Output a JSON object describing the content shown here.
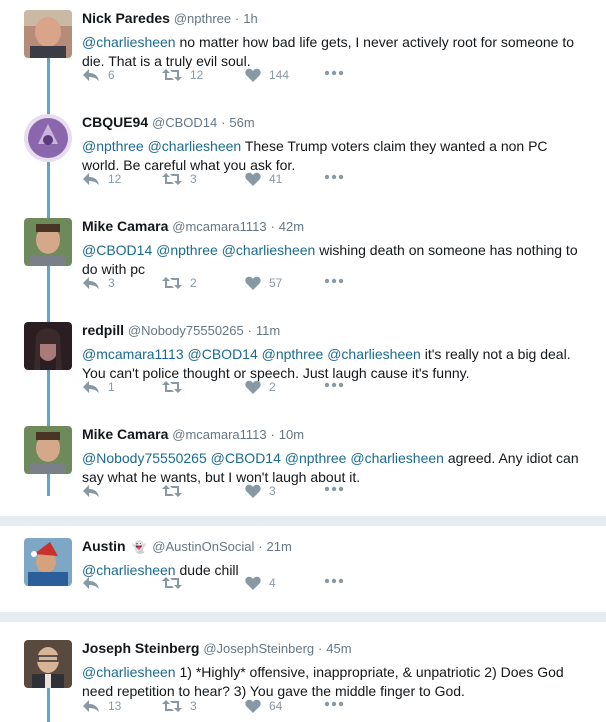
{
  "tweets_group1": [
    {
      "name": "Nick Paredes",
      "handle": "@npthree",
      "time": "1h",
      "mentions": "@charliesheen",
      "text": " no matter how bad life gets, I never actively root for someone to die. That is a truly evil soul.",
      "replies": "6",
      "retweets": "12",
      "likes": "144"
    },
    {
      "name": "CBQUE94",
      "handle": "@CBOD14",
      "time": "56m",
      "mentions": "@npthree @charliesheen",
      "text": " These Trump voters claim they wanted a non PC world. Be careful what you ask for.",
      "replies": "12",
      "retweets": "3",
      "likes": "41"
    },
    {
      "name": "Mike Camara",
      "handle": "@mcamara1113",
      "time": "42m",
      "mentions": "@CBOD14 @npthree @charliesheen",
      "text": " wishing death on someone has nothing to do with pc",
      "replies": "3",
      "retweets": "2",
      "likes": "57"
    },
    {
      "name": "redpill",
      "handle": "@Nobody75550265",
      "time": "11m",
      "mentions": "@mcamara1113 @CBOD14 @npthree @charliesheen",
      "text": " it's really not a big deal. You can't police thought or speech. Just laugh cause it's funny.",
      "replies": "1",
      "retweets": "",
      "likes": "2"
    },
    {
      "name": "Mike Camara",
      "handle": "@mcamara1113",
      "time": "10m",
      "mentions": "@Nobody75550265 @CBOD14 @npthree @charliesheen",
      "text": " agreed. Any idiot can say what he wants, but I won't laugh about it.",
      "replies": "",
      "retweets": "",
      "likes": "3"
    }
  ],
  "tweet_austin": {
    "name": "Austin",
    "emoji": "👻",
    "handle": "@AustinOnSocial",
    "time": "21m",
    "mentions": "@charliesheen",
    "text": " dude chill",
    "replies": "",
    "retweets": "",
    "likes": "4"
  },
  "tweet_joseph": {
    "name": "Joseph Steinberg",
    "handle": "@JosephSteinberg",
    "time": "45m",
    "mentions": "@charliesheen",
    "text": " 1) *Highly* offensive, inappropriate, & unpatriotic 2) Does God need repetition to hear? 3) You gave the middle finger to God.",
    "replies": "13",
    "retweets": "3",
    "likes": "64"
  },
  "separator": "·",
  "colors": {
    "mention": "#1b6b91",
    "thread_line": "#64a4c8",
    "icon": "#8899a6",
    "background": "#e6ecf0"
  }
}
